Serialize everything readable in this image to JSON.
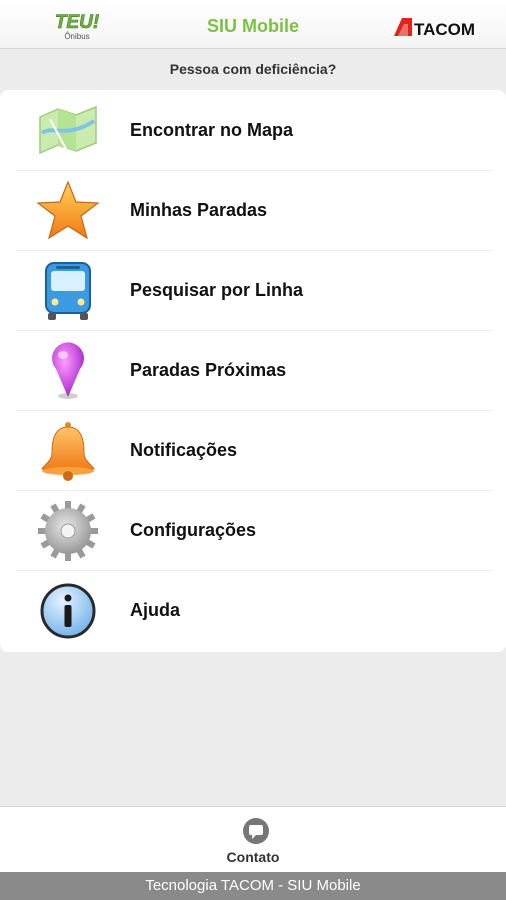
{
  "header": {
    "logo_left_text": "TEU!",
    "logo_left_sub": "Ônibus",
    "title": "SIU Mobile",
    "logo_right_text": "TACOM"
  },
  "subtitle": "Pessoa com deficiência?",
  "menu": {
    "items": [
      {
        "label": "Encontrar no Mapa",
        "icon": "map-icon"
      },
      {
        "label": "Minhas Paradas",
        "icon": "star-icon"
      },
      {
        "label": "Pesquisar por Linha",
        "icon": "bus-icon"
      },
      {
        "label": "Paradas Próximas",
        "icon": "location-pin-icon"
      },
      {
        "label": "Notificações",
        "icon": "bell-icon"
      },
      {
        "label": "Configurações",
        "icon": "gear-icon"
      },
      {
        "label": "Ajuda",
        "icon": "info-icon"
      }
    ]
  },
  "footer": {
    "contact_label": "Contato",
    "bottom_text": "Tecnologia TACOM - SIU Mobile"
  },
  "colors": {
    "title_green": "#7cc142",
    "tacom_red": "#e2231a"
  }
}
